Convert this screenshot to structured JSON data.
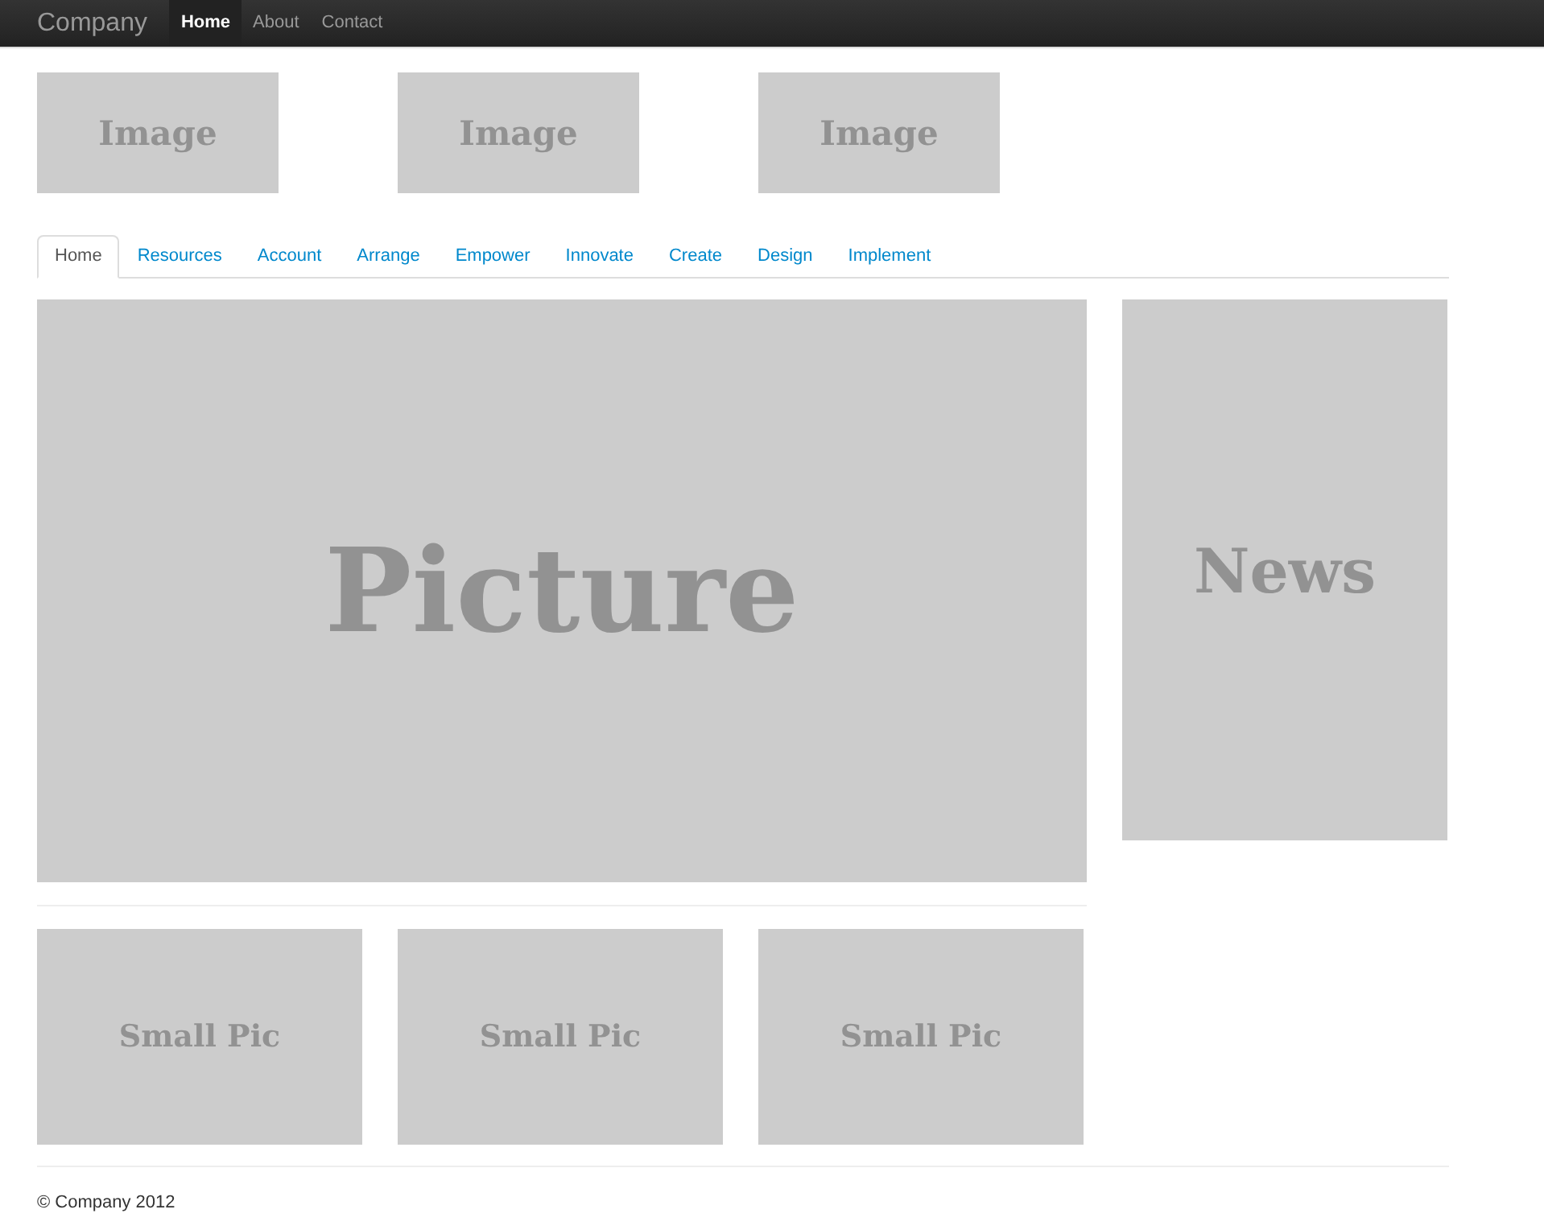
{
  "navbar": {
    "brand": "Company",
    "links": [
      {
        "label": "Home",
        "selected": true
      },
      {
        "label": "About",
        "selected": false
      },
      {
        "label": "Contact",
        "selected": false
      }
    ]
  },
  "top_images": [
    "Image",
    "Image",
    "Image"
  ],
  "tabs": [
    {
      "label": "Home",
      "selected": true
    },
    {
      "label": "Resources",
      "selected": false
    },
    {
      "label": "Account",
      "selected": false
    },
    {
      "label": "Arrange",
      "selected": false
    },
    {
      "label": "Empower",
      "selected": false
    },
    {
      "label": "Innovate",
      "selected": false
    },
    {
      "label": "Create",
      "selected": false
    },
    {
      "label": "Design",
      "selected": false
    },
    {
      "label": "Implement",
      "selected": false
    }
  ],
  "main_picture": "Picture",
  "news": "News",
  "small_pics": [
    "Small Pic",
    "Small Pic",
    "Small Pic"
  ],
  "footer": "© Company 2012"
}
